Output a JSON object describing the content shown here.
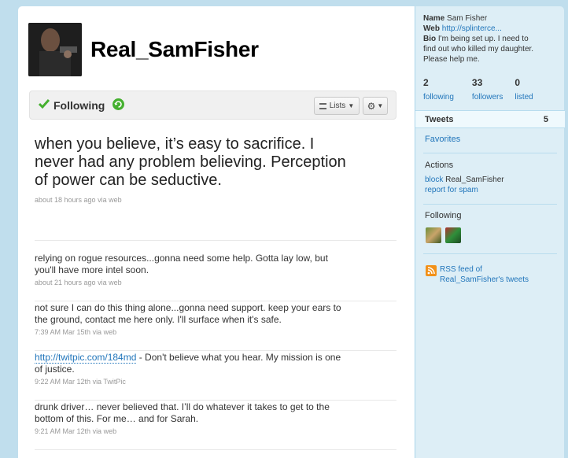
{
  "profile": {
    "screen_name": "Real_SamFisher",
    "follow_status": "Following",
    "lists_button": "Lists"
  },
  "tweets": [
    {
      "text": "when you believe, it’s easy to sacrifice. I never had any problem believing. Perception of power can be seductive.",
      "time": "about 18 hours ago",
      "via": "via",
      "source": "web"
    },
    {
      "text": "relying on rogue resources...gonna need some help. Gotta lay low, but you'll have more intel soon.",
      "time": "about 21 hours ago",
      "via": "via",
      "source": "web"
    },
    {
      "text": "not sure I can do this thing alone...gonna need support. keep your ears to the ground, contact me here only. I'll surface when it's safe.",
      "time": "7:39 AM Mar 15th",
      "via": "via",
      "source": "web"
    },
    {
      "link": "http://twitpic.com/184md",
      "text": " - Don't believe what you hear. My mission is one of justice.",
      "time": "9:22 AM Mar 12th",
      "via": "via",
      "source": "TwitPic"
    },
    {
      "text": "drunk driver… never believed that. I’ll do whatever it takes to get to the bottom of this. For me… and for Sarah.",
      "time": "9:21 AM Mar 12th",
      "via": "via",
      "source": "web"
    }
  ],
  "sidebar": {
    "name_label": "Name",
    "name_value": "Sam Fisher",
    "web_label": "Web",
    "web_value": "http://splinterce...",
    "bio_label": "Bio",
    "bio_value": "I'm being set up. I need to find out who killed my daughter. Please help me.",
    "stats": [
      {
        "count": "2",
        "label": "following"
      },
      {
        "count": "33",
        "label": "followers"
      },
      {
        "count": "0",
        "label": "listed"
      }
    ],
    "tweets_label": "Tweets",
    "tweets_count": "5",
    "favorites_label": "Favorites",
    "actions_heading": "Actions",
    "block_label": "block",
    "block_target": "Real_SamFisher",
    "report_label": "report for spam",
    "following_heading": "Following",
    "rss_line1": "RSS feed of",
    "rss_line2": "Real_SamFisher's tweets"
  },
  "colors": {
    "background": "#c0deed",
    "link": "#2276bb",
    "sidebar": "#ddeef6",
    "follow_check": "#45b02f"
  }
}
